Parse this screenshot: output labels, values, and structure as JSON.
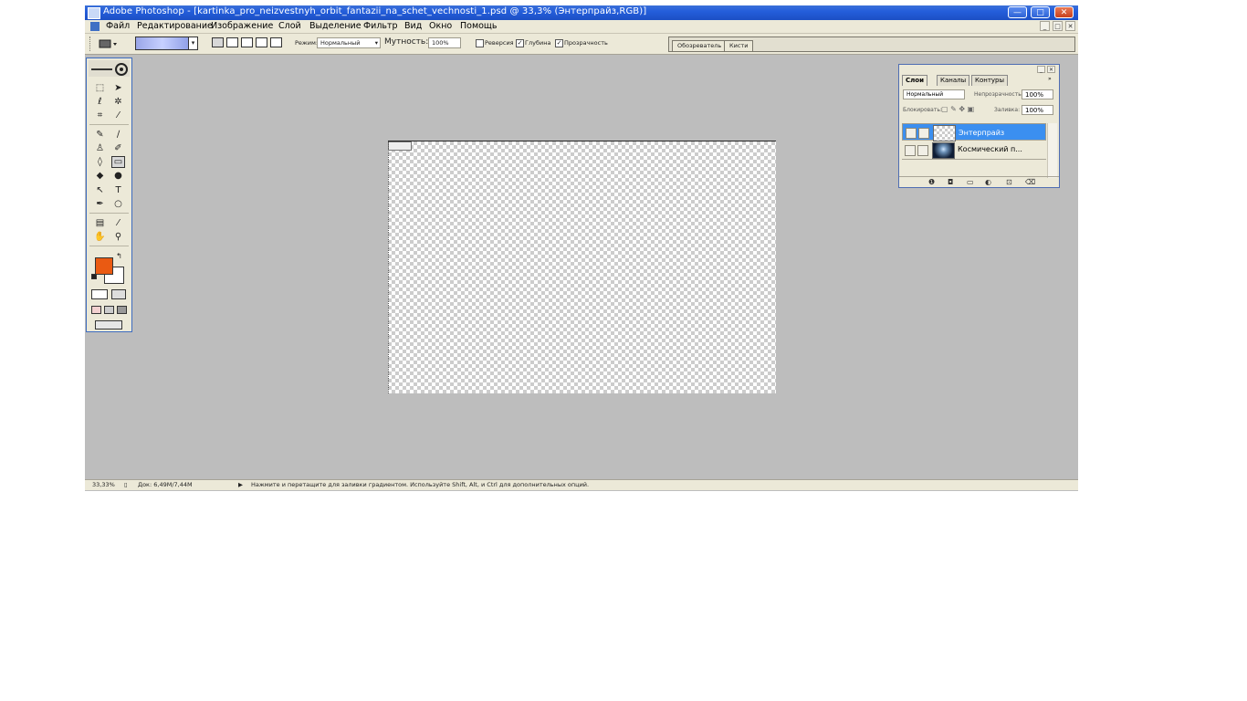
{
  "window": {
    "title": "Adobe Photoshop - [kartinka_pro_neizvestnyh_orbit_fantazii_na_schet_vechnosti_1.psd @ 33,3% (Энтерпрайз,RGB)]",
    "btn_min": "—",
    "btn_max": "□",
    "btn_close": "✕"
  },
  "menu": {
    "items": [
      "Файл",
      "Редактирование",
      "Изображение",
      "Слой",
      "Выделение",
      "Фильтр",
      "Вид",
      "Окно",
      "Помощь"
    ],
    "doc_min": "_",
    "doc_max": "□",
    "doc_close": "✕"
  },
  "options": {
    "mode_label": "Режим:",
    "mode_value": "Нормальный",
    "opacity_label": "Мутность:",
    "opacity_value": "100%",
    "reverse_label": "Реверсия",
    "dither_label": "Глубина",
    "transparency_label": "Прозрачность",
    "reverse_checked": false,
    "dither_checked": true,
    "transparency_checked": true,
    "palette_tabs": [
      "Обозреватель",
      "Кисти"
    ]
  },
  "toolbox": {
    "colors": {
      "foreground": "#ea5a12",
      "background": "#ffffff"
    }
  },
  "layers": {
    "tabs": [
      "Слои",
      "Каналы",
      "Контуры"
    ],
    "blend_mode": "Нормальный",
    "opacity_label": "Непрозрачность:",
    "opacity_value": "100%",
    "lock_label": "Блокировать:",
    "fill_label": "Заливка:",
    "fill_value": "100%",
    "rows": [
      {
        "name": "Энтерпрайз",
        "selected": true
      },
      {
        "name": "Космический п...",
        "selected": false
      }
    ]
  },
  "status": {
    "zoom": "33,33%",
    "doc_info": "Док: 6,49M/7,44M",
    "hint": "Нажмите и перетащите для заливки градиентом. Используйте Shift, Alt, и Ctrl для дополнительных опций."
  }
}
